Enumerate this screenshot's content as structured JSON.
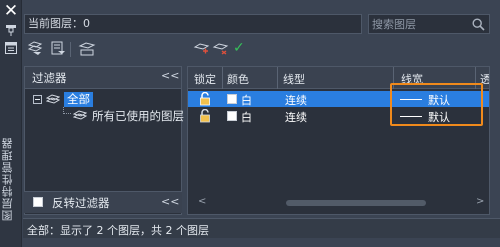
{
  "panel": {
    "close_icon": "close-icon",
    "vertical_title": "图层特性管理器"
  },
  "header": {
    "current_layer": "当前图层：0",
    "search_placeholder": "搜索图层"
  },
  "toolbar": {
    "icons": [
      "new-property-filter-icon",
      "new-group-filter-icon",
      "layer-states-manager-icon",
      "new-layer-icon",
      "delete-layer-icon",
      "set-current-check-icon"
    ],
    "set_current_glyph": "✓"
  },
  "filters": {
    "title": "过滤器",
    "collapse_glyph": "<<",
    "tree": {
      "all_label": "全部",
      "used_label": "所有已使用的图层"
    },
    "invert_label": "反转过滤器",
    "invert_checked": false
  },
  "table": {
    "columns": [
      "锁定",
      "颜色",
      "线型",
      "线宽",
      "透"
    ],
    "rows": [
      {
        "locked": false,
        "color": "白",
        "linetype": "连续",
        "lineweight": "默认",
        "selected": true
      },
      {
        "locked": false,
        "color": "白",
        "linetype": "连续",
        "lineweight": "默认",
        "selected": false
      }
    ]
  },
  "scroll": {
    "left_arrow": "<",
    "right_arrow": ">"
  },
  "status": {
    "text": "全部：显示了 2 个图层，共 2 个图层"
  },
  "colors": {
    "background": "#3b4453",
    "selected_row": "#2a7ee0",
    "highlight_box": "#f08a1c",
    "check_green": "#36c15a"
  }
}
